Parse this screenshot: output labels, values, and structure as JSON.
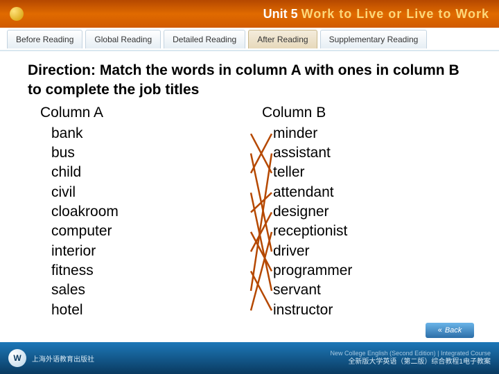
{
  "header": {
    "unit_label": "Unit 5",
    "title_text": "Work to Live or Live to Work"
  },
  "tabs": {
    "items": [
      {
        "label": "Before Reading",
        "active": false
      },
      {
        "label": "Global Reading",
        "active": false
      },
      {
        "label": "Detailed Reading",
        "active": false
      },
      {
        "label": "After Reading",
        "active": true
      },
      {
        "label": "Supplementary Reading",
        "active": false
      }
    ]
  },
  "content": {
    "direction": "Direction: Match the words in column A with ones in column B to complete the job titles",
    "column_a_header": "Column A",
    "column_b_header": "Column B",
    "column_a": [
      "bank",
      "bus",
      "child",
      "civil",
      "cloakroom",
      "computer",
      "interior",
      "fitness",
      "sales",
      "hotel"
    ],
    "column_b": [
      "minder",
      "assistant",
      "teller",
      "attendant",
      "designer",
      "receptionist",
      "driver",
      "programmer",
      "servant",
      "instructor"
    ],
    "matches": [
      [
        0,
        2
      ],
      [
        1,
        6
      ],
      [
        2,
        0
      ],
      [
        3,
        8
      ],
      [
        4,
        3
      ],
      [
        5,
        7
      ],
      [
        6,
        4
      ],
      [
        7,
        9
      ],
      [
        8,
        1
      ],
      [
        9,
        5
      ]
    ]
  },
  "back_btn": "Back",
  "footer": {
    "logo_text": "W",
    "publisher": "上海外语教育出版社",
    "line1_cn": "全新版大学英语（第二版）综合教程1电子教案",
    "line1_en": "New College English (Second Edition) | Integrated Course"
  },
  "chart_data": {
    "type": "table",
    "title": "Match the words in column A with ones in column B to complete the job titles",
    "column_a": [
      "bank",
      "bus",
      "child",
      "civil",
      "cloakroom",
      "computer",
      "interior",
      "fitness",
      "sales",
      "hotel"
    ],
    "column_b": [
      "minder",
      "assistant",
      "teller",
      "attendant",
      "designer",
      "receptionist",
      "driver",
      "programmer",
      "servant",
      "instructor"
    ],
    "pairs": [
      [
        "bank",
        "teller"
      ],
      [
        "bus",
        "driver"
      ],
      [
        "child",
        "minder"
      ],
      [
        "civil",
        "servant"
      ],
      [
        "cloakroom",
        "attendant"
      ],
      [
        "computer",
        "programmer"
      ],
      [
        "interior",
        "designer"
      ],
      [
        "fitness",
        "instructor"
      ],
      [
        "sales",
        "assistant"
      ],
      [
        "hotel",
        "receptionist"
      ]
    ]
  }
}
